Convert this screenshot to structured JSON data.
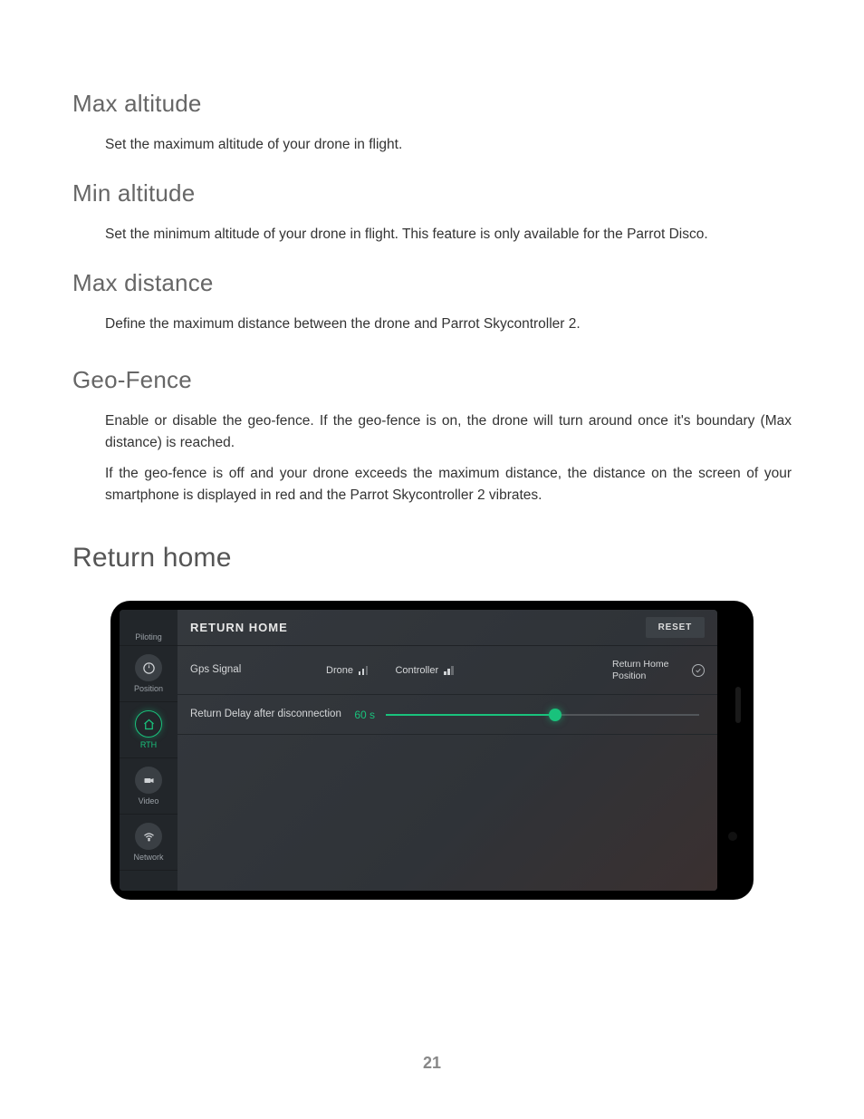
{
  "sections": {
    "maxAlt": {
      "title": "Max altitude",
      "body": "Set the maximum altitude of your drone in flight."
    },
    "minAlt": {
      "title": "Min altitude",
      "body": "Set the minimum altitude of your drone in flight. This feature is only available for the Parrot Disco."
    },
    "maxDist": {
      "title": "Max distance",
      "body": "Define the maximum distance between the drone and Parrot Skycontroller 2."
    },
    "geoFence": {
      "title": "Geo-Fence",
      "body1": "Enable or disable the geo-fence. If the geo-fence is on, the drone will turn around once it's boundary (Max distance) is reached.",
      "body2": "If the geo-fence is off and your drone exceeds the maximum distance, the distance on the screen of your smartphone is displayed in red and the Parrot Skycontroller 2 vibrates."
    },
    "returnHome": {
      "title": "Return home"
    }
  },
  "phone": {
    "sidebar": {
      "piloting": "Piloting",
      "position": "Position",
      "rth": "RTH",
      "video": "Video",
      "network": "Network"
    },
    "header": {
      "title": "RETURN HOME",
      "reset": "RESET"
    },
    "gpsRow": {
      "label": "Gps Signal",
      "drone": "Drone",
      "controller": "Controller",
      "rhp": "Return Home Position"
    },
    "delayRow": {
      "label": "Return Delay after disconnection",
      "value": "60 s"
    }
  },
  "pageNumber": "21"
}
